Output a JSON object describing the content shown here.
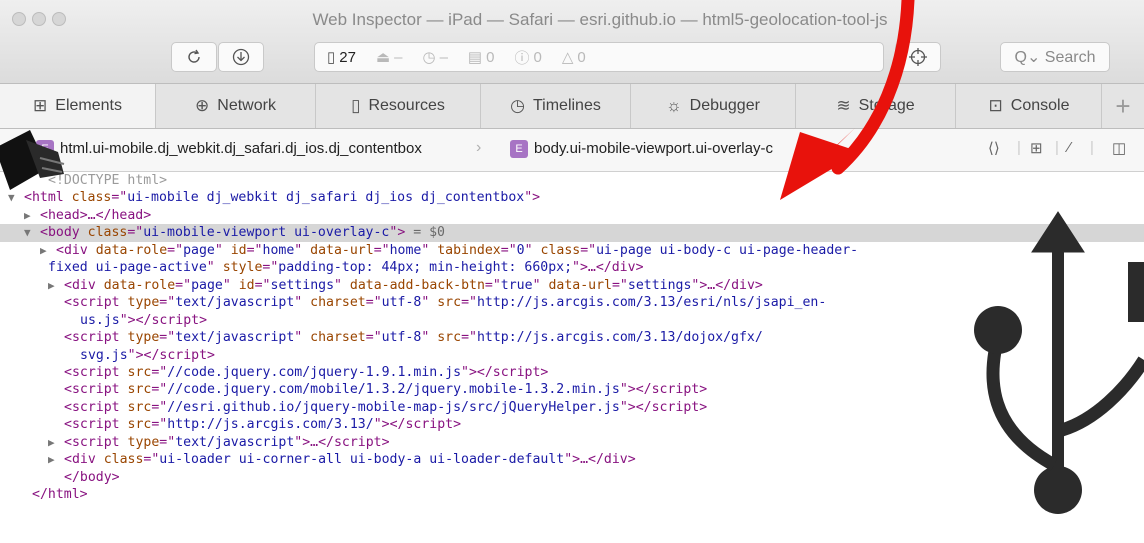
{
  "window": {
    "title": "Web Inspector — iPad — Safari — esri.github.io — html5-geolocation-tool-js"
  },
  "toolbar": {
    "resource_count": "27",
    "loads": "–",
    "time": "–",
    "logs": "0",
    "errors": "0",
    "warnings": "0",
    "search_placeholder": "Q⌄ Search"
  },
  "tabs": [
    {
      "label": "Elements",
      "icon": "elements-icon"
    },
    {
      "label": "Network",
      "icon": "network-icon"
    },
    {
      "label": "Resources",
      "icon": "resources-icon"
    },
    {
      "label": "Timelines",
      "icon": "timelines-icon"
    },
    {
      "label": "Debugger",
      "icon": "debugger-icon"
    },
    {
      "label": "Storage",
      "icon": "storage-icon"
    },
    {
      "label": "Console",
      "icon": "console-icon"
    }
  ],
  "breadcrumb": {
    "html_item": "html.ui-mobile.dj_webkit.dj_safari.dj_ios.dj_contentbox",
    "html_badge": "E",
    "body_item": "body.ui-mobile-viewport.ui-overlay-c",
    "body_badge": "E"
  },
  "dom": {
    "doctype": "<!DOCTYPE html>",
    "html_open": [
      "<html ",
      "class",
      "=\"",
      "ui-mobile dj_webkit dj_safari dj_ios dj_contentbox",
      "\">"
    ],
    "head": "<head>…</head>",
    "body_class": "ui-mobile-viewport ui-overlay-c",
    "body_suffix": " = $0",
    "div_home_id": "home",
    "div_home_role": "page",
    "div_home_url": "home",
    "div_home_tabindex": "0",
    "div_home_class_a": "ui-page ui-body-c ui-page-header-",
    "div_home_class_b": "fixed ui-page-active",
    "div_home_style": "padding-top: 44px; min-height: 660px;",
    "div_settings_role": "page",
    "div_settings_id": "settings",
    "div_settings_back": "true",
    "div_settings_url": "settings",
    "script_type": "text/javascript",
    "script_charset": "utf-8",
    "script1_src_a": "http://js.arcgis.com/3.13/esri/nls/jsapi_en-",
    "script1_src_b": "us.js",
    "script2_src_a": "http://js.arcgis.com/3.13/dojox/gfx/",
    "script2_src_b": "svg.js",
    "script3_src": "//code.jquery.com/jquery-1.9.1.min.js",
    "script4_src": "//code.jquery.com/mobile/1.3.2/jquery.mobile-1.3.2.min.js",
    "script5_src": "//esri.github.io/jquery-mobile-map-js/src/jQueryHelper.js",
    "script6_src": "http://js.arcgis.com/3.13/",
    "inline_script_type": "text/javascript",
    "loader_class": "ui-loader ui-corner-all ui-body-a ui-loader-default",
    "body_close": "</body>",
    "html_close": "</html>"
  },
  "colors": {
    "tag": "#881280",
    "attr_name": "#994500",
    "attr_value": "#1a1aa6",
    "selected_row": "#d6d6d6",
    "arrow": "#e8120c",
    "usb_symbol": "#2b2b2b"
  },
  "overlay": {
    "arrow": "red-curved-arrow",
    "cable": "usb-cable-plug",
    "symbol": "usb-symbol"
  }
}
